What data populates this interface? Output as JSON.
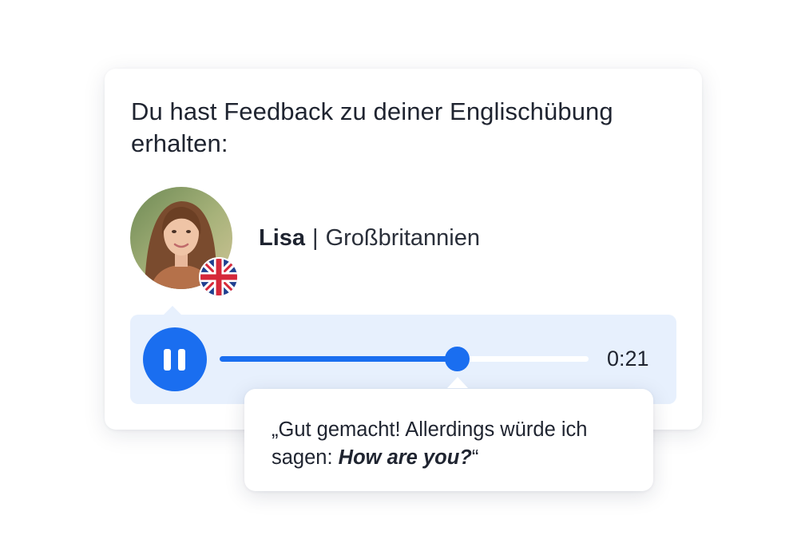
{
  "card": {
    "headline": "Du hast Feedback zu deiner Englischübung erhalten:"
  },
  "tutor": {
    "name": "Lisa",
    "separator": "|",
    "country": "Großbritannien",
    "avatar_icon": "person-photo",
    "flag_icon": "uk-flag-icon"
  },
  "player": {
    "state": "playing",
    "button_icon": "pause-icon",
    "progress_fraction": 0.645,
    "time": "0:21"
  },
  "feedback": {
    "open_quote": "„",
    "text_before": "Gut gemacht! Allerdings würde ich sagen: ",
    "emphasis": "How are you?",
    "close_quote": "“"
  },
  "colors": {
    "accent": "#1a6ef0",
    "player_background": "#e7f0fd",
    "text": "#1f2430"
  }
}
